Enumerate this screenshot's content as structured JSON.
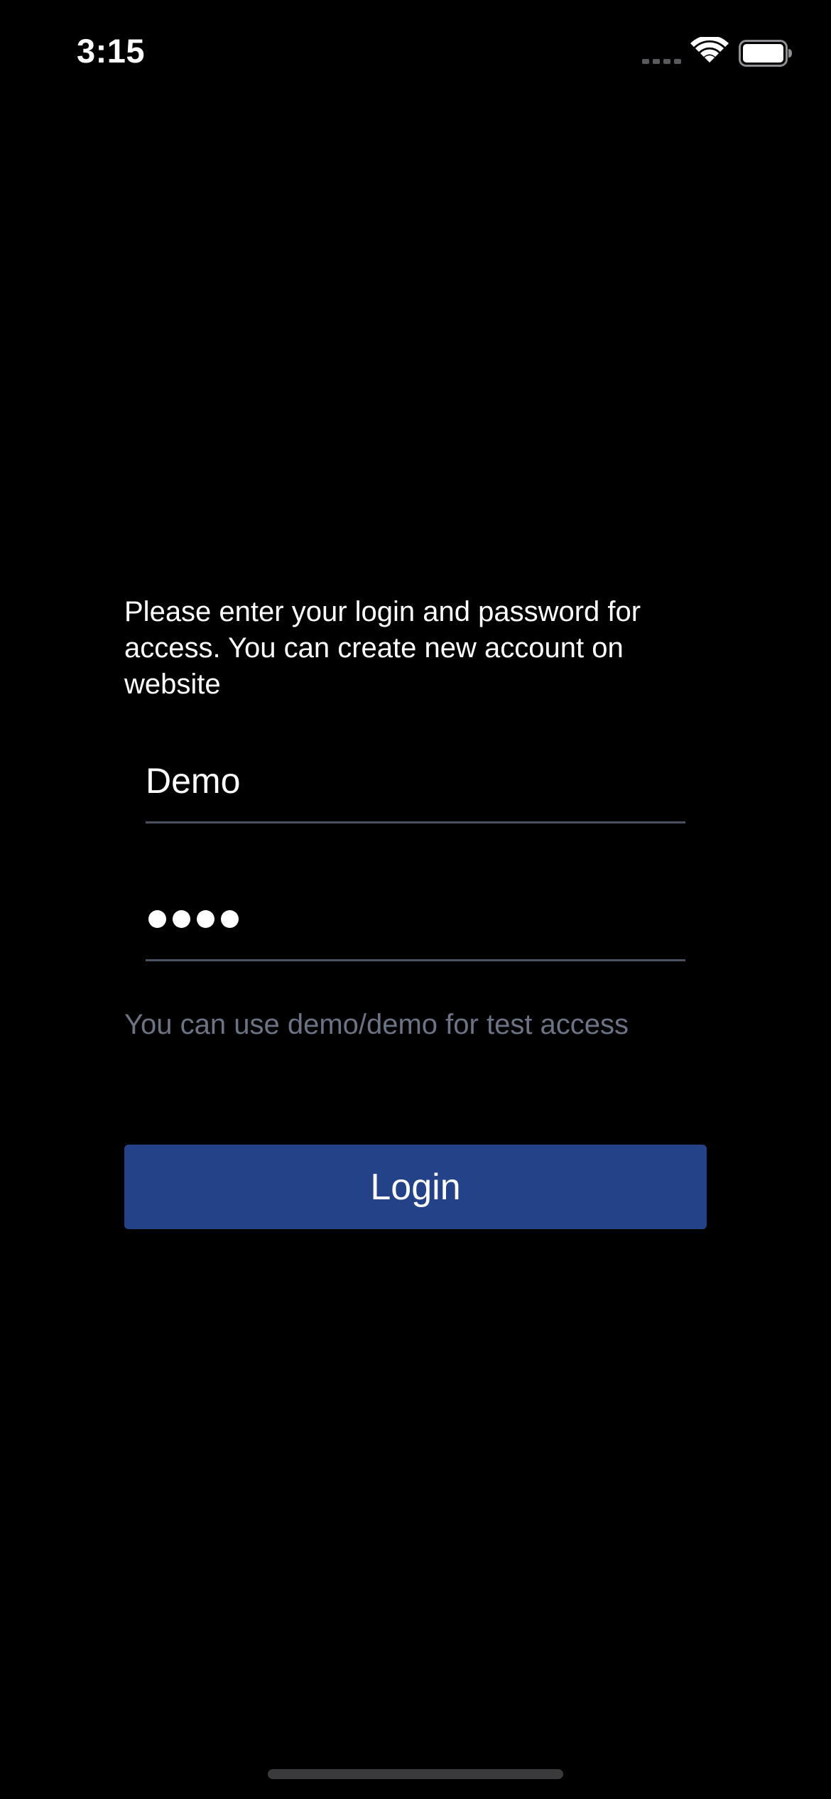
{
  "status_bar": {
    "time": "3:15",
    "icons": [
      "signal-icon",
      "wifi-icon",
      "battery-icon"
    ]
  },
  "login_form": {
    "intro_text": "Please enter your login and password for access. You can create new account on website",
    "login_value": "Demo",
    "password_masked": true,
    "password_length": 4,
    "hint_text": "You can use demo/demo for test access",
    "login_button_label": "Login"
  },
  "colors": {
    "background": "#000000",
    "button": "#234288",
    "field_underline": "#4a5163",
    "hint_text": "#6b7384"
  }
}
